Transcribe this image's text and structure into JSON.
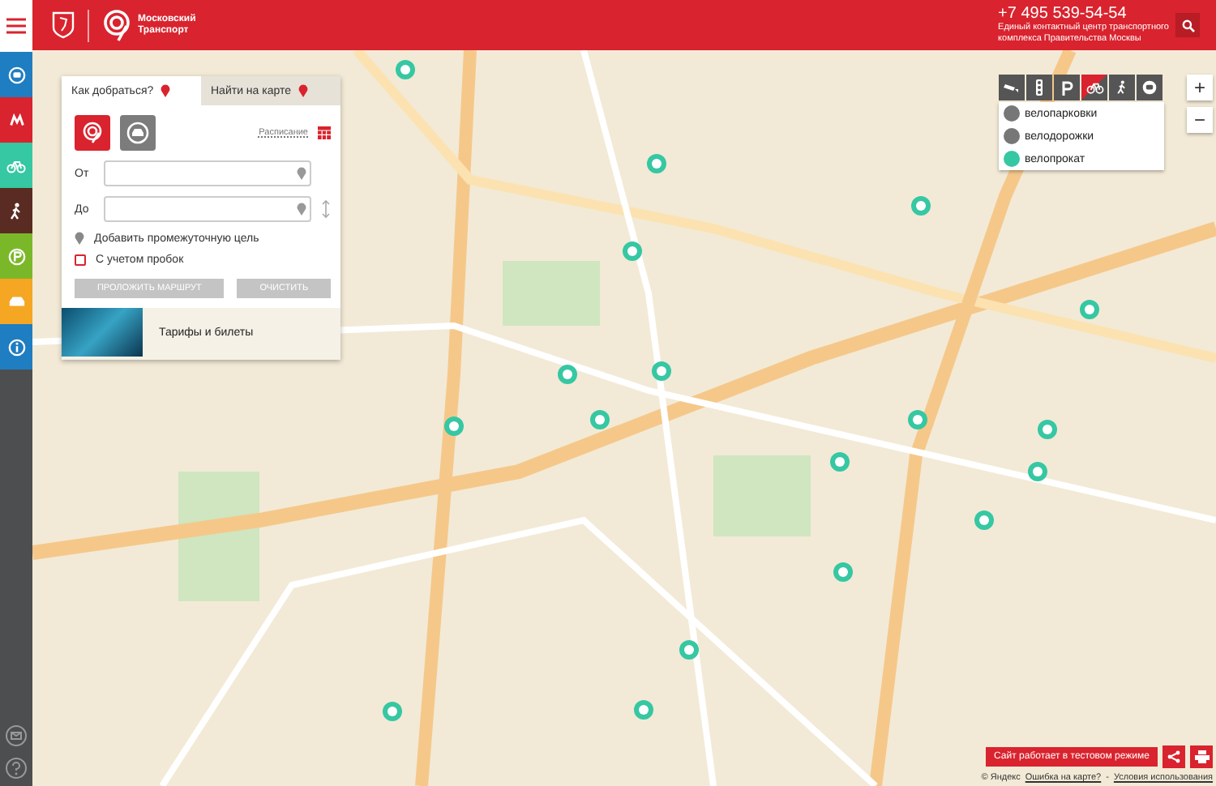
{
  "sidebar": {
    "items": [
      {
        "kind": "bus",
        "color": "#1f7dc1"
      },
      {
        "kind": "metro",
        "color": "#d9232e"
      },
      {
        "kind": "bike",
        "color": "#36c7a3"
      },
      {
        "kind": "walk",
        "color": "#5a2b22"
      },
      {
        "kind": "parking",
        "color": "#7ab829"
      },
      {
        "kind": "taxi",
        "color": "#f5a623"
      },
      {
        "kind": "info",
        "color": "#1f7dc1"
      }
    ],
    "bottom_items": [
      {
        "kind": "mail"
      },
      {
        "kind": "help"
      }
    ]
  },
  "header": {
    "logo_text": [
      "Московский",
      "Транспорт"
    ],
    "phone": "+7 495 539-54-54",
    "subtitle": [
      "Единый контактный центр транспортного",
      "комплекса Правительства Москвы"
    ]
  },
  "route_panel": {
    "tabs": [
      {
        "label": "Как добраться?",
        "selected": true
      },
      {
        "label": "Найти на карте",
        "selected": false
      }
    ],
    "modes": [
      {
        "kind": "transport",
        "selected": true
      },
      {
        "kind": "car",
        "selected": false
      }
    ],
    "schedule_link": "Расписание",
    "from_label": "От",
    "to_label": "До",
    "add_stop": "Добавить промежуточную цель",
    "traffic": {
      "label": "С учетом пробок",
      "checked": false
    },
    "buttons": [
      {
        "label": "ПРОЛОЖИТЬ МАРШРУТ",
        "disabled": true
      },
      {
        "label": "ОЧИСТИТЬ",
        "disabled": true
      }
    ],
    "banner": {
      "title": "Тарифы и билеты"
    }
  },
  "layers": {
    "tools": [
      {
        "kind": "camera",
        "selected": false
      },
      {
        "kind": "traffic-light",
        "selected": false
      },
      {
        "kind": "parking",
        "selected": false
      },
      {
        "kind": "bike",
        "selected": true
      },
      {
        "kind": "walk",
        "selected": false
      },
      {
        "kind": "bus",
        "selected": false
      }
    ],
    "items": [
      {
        "label": "велопарковки",
        "selected": false
      },
      {
        "label": "велодорожки",
        "selected": false
      },
      {
        "label": "велопрокат",
        "selected": true
      }
    ]
  },
  "zoom": [
    "+",
    "−"
  ],
  "footer": {
    "notice": "Сайт работает в тестовом режиме",
    "copyright": "© Яндекс",
    "error_link": "Ошибка на карте?",
    "separator": "-",
    "terms_link": "Условия использования"
  }
}
